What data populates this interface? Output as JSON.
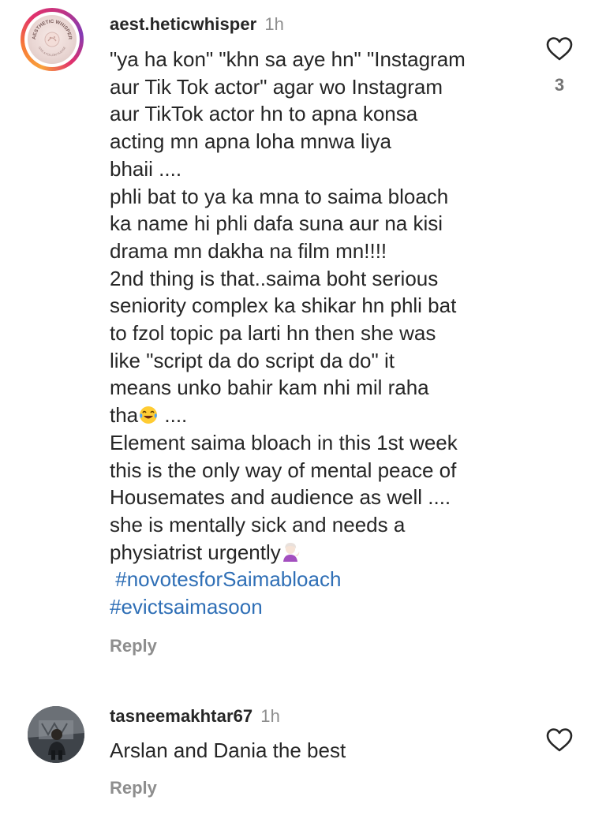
{
  "comments": [
    {
      "username": "aest.heticwhisper",
      "time": "1h",
      "avatar_text": "AESTHETIC WHISPER",
      "avatar_subtext": "GIVE A FOLLOW PLEASE",
      "lines": [
        "\"ya ha kon\" \"khn sa aye hn\" \"Instagram",
        "aur Tik Tok actor\" agar wo Instagram",
        "aur TikTok actor hn to apna konsa",
        "acting mn apna loha mnwa liya",
        "bhaii ....",
        "phli bat to ya ka mna to saima bloach",
        "ka name hi phli dafa suna aur na kisi",
        "drama mn dakha na film mn!!!!",
        "2nd thing is that..saima boht serious",
        "seniority complex ka shikar hn phli bat",
        "to fzol topic pa larti hn then she was",
        "like \"script da do script da do\" it",
        "means unko bahir kam nhi mil raha",
        "tha",
        " ....",
        "Element saima bloach in this 1st week",
        "this is the only way of mental peace of",
        "Housemates and audience as well ....",
        "she is mentally sick and needs a",
        "physiatrist urgently"
      ],
      "hashtags": [
        " #novotesforSaimabloach",
        "#evictsaimasoon"
      ],
      "reply_label": "Reply",
      "like_count": "3",
      "emoji_laugh": "laughing-with-tears",
      "emoji_shrug": "person-tipping-hand"
    },
    {
      "username": "tasneemakhtar67",
      "time": "1h",
      "text": "Arslan and Dania the best",
      "reply_label": "Reply"
    }
  ],
  "icons": {
    "like": "heart-outline-icon"
  },
  "colors": {
    "text": "#262626",
    "muted": "#8e8e8e",
    "hashtag": "#2f6fb6",
    "story_ring_start": "#f9a23b",
    "story_ring_end": "#c13584"
  }
}
